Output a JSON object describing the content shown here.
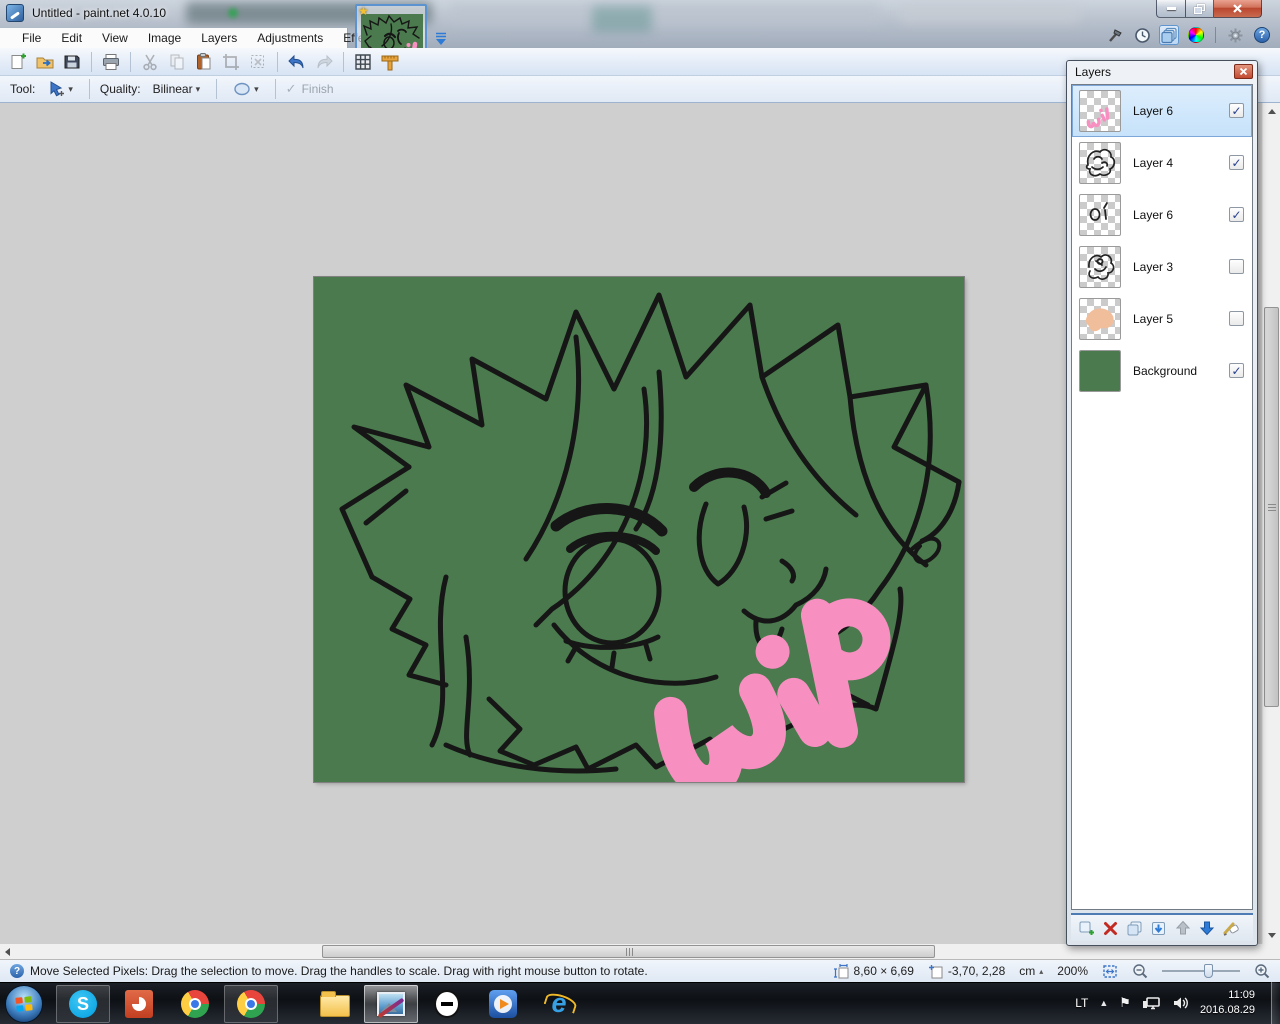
{
  "window": {
    "title": "Untitled - paint.net 4.0.10"
  },
  "menu": {
    "items": [
      "File",
      "Edit",
      "View",
      "Image",
      "Layers",
      "Adjustments",
      "Effects"
    ]
  },
  "toolbar": {
    "buttons": [
      "new",
      "open",
      "save",
      "print",
      "cut",
      "copy",
      "paste",
      "crop-to-selection",
      "deselect",
      "undo",
      "redo",
      "toggle-grid",
      "toggle-rulers"
    ]
  },
  "tool_options": {
    "tool_label": "Tool:",
    "quality_label": "Quality:",
    "quality_value": "Bilinear",
    "finish_label": "Finish"
  },
  "layers_panel": {
    "title": "Layers",
    "items": [
      {
        "name": "Layer 6",
        "visible": true,
        "selected": true,
        "thumb": "wip-pink"
      },
      {
        "name": "Layer 4",
        "visible": true,
        "selected": false,
        "thumb": "sketch"
      },
      {
        "name": "Layer 6",
        "visible": true,
        "selected": false,
        "thumb": "small-marks"
      },
      {
        "name": "Layer 3",
        "visible": false,
        "selected": false,
        "thumb": "sketch"
      },
      {
        "name": "Layer 5",
        "visible": false,
        "selected": false,
        "thumb": "peach-blob"
      },
      {
        "name": "Background",
        "visible": true,
        "selected": false,
        "thumb": "solid-green"
      }
    ],
    "buttons": [
      "add-layer",
      "delete-layer",
      "duplicate-layer",
      "merge-layer-down",
      "move-layer-up",
      "move-layer-down",
      "layer-properties"
    ]
  },
  "status_bar": {
    "message": "Move Selected Pixels: Drag the selection to move. Drag the handles to scale. Drag with right mouse button to rotate.",
    "canvas_size": "8,60 × 6,69",
    "cursor_position": "-3,70, 2,28",
    "unit": "cm",
    "zoom_level": "200%"
  },
  "taskbar": {
    "items": [
      "start",
      "skype",
      "powerpoint",
      "chrome",
      "chrome-2",
      "explorer",
      "paintdotnet",
      "recording",
      "media-player",
      "internet-explorer"
    ],
    "tray": {
      "language": "LT",
      "time": "11:09",
      "date": "2016.08.29"
    }
  },
  "icons": {
    "check": "✓",
    "star": "★",
    "dropdown": "▾",
    "unit_dropdown": "▴",
    "help": "?",
    "flag": "⚑",
    "tray_expand": "▲",
    "skype_glyph": "S",
    "ie_glyph": "e"
  },
  "colors": {
    "canvas_green": "#4A7A4D",
    "wip_pink": "#F78FC1"
  }
}
